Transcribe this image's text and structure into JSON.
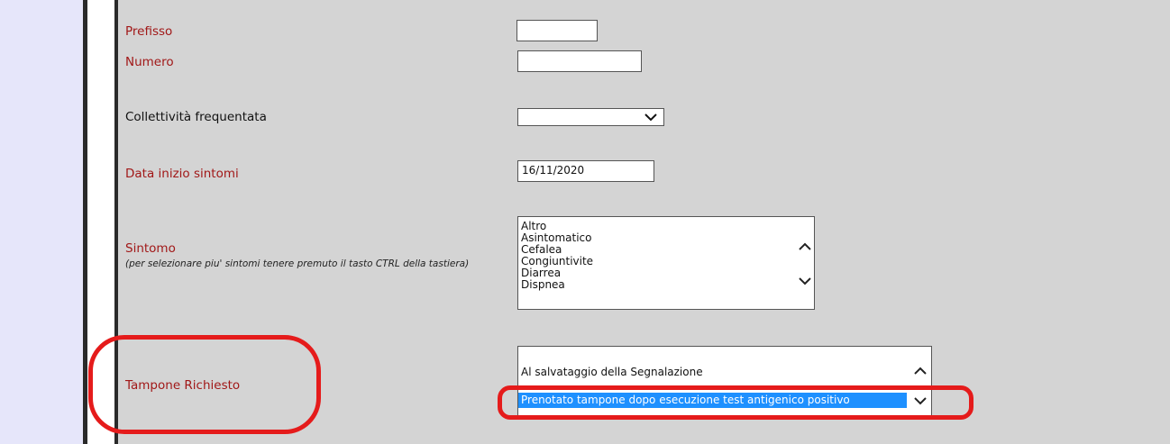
{
  "form": {
    "prefisso": {
      "label": "Prefisso",
      "value": ""
    },
    "numero": {
      "label": "Numero",
      "value": ""
    },
    "collettivita": {
      "label": "Collettività frequentata",
      "value": ""
    },
    "data_inizio": {
      "label": "Data inizio sintomi",
      "value": "16/11/2020"
    },
    "sintomo": {
      "label": "Sintomo",
      "hint": "(per selezionare piu' sintomi tenere premuto il tasto CTRL della tastiera)",
      "options": [
        "Altro",
        "Asintomatico",
        "Cefalea",
        "Congiuntivite",
        "Diarrea",
        "Dispnea"
      ]
    },
    "tampone": {
      "label": "Tampone Richiesto",
      "options": [
        "Al salvataggio della Segnalazione",
        "Prenotato tampone dopo esecuzione test antigenico positivo"
      ],
      "selected_index": 1
    }
  },
  "colors": {
    "label_red": "#a11818",
    "annotation_red": "#e51b1b",
    "selection_blue": "#1e90ff",
    "background": "#d4d4d4",
    "left_panel": "#e6e6fa"
  },
  "icons": [
    "chevron-down-icon",
    "chevron-up-icon"
  ]
}
